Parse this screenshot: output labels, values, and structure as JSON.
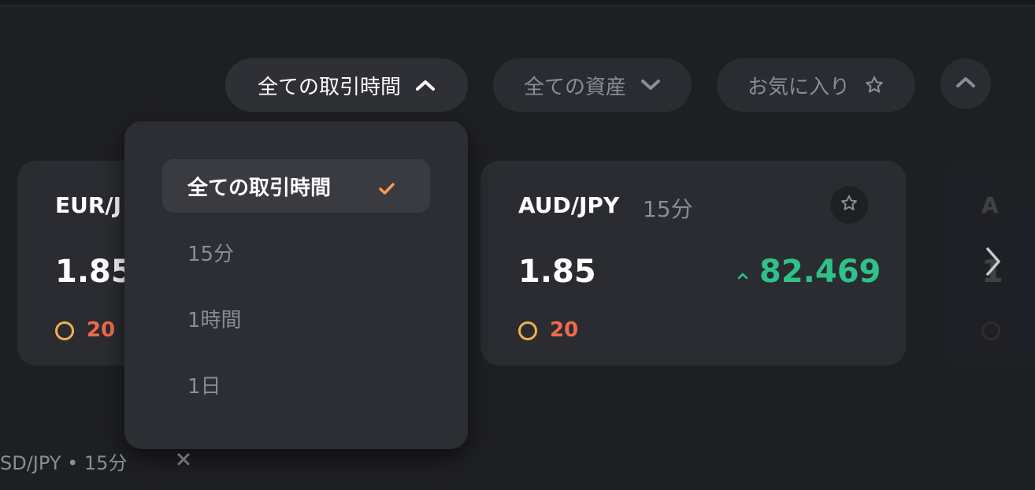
{
  "filters": {
    "trading_time_label": "全ての取引時間",
    "assets_label": "全ての資産",
    "favorites_label": "お気に入り"
  },
  "dropdown": {
    "items": [
      {
        "label": "全ての取引時間",
        "selected": true
      },
      {
        "label": "15分",
        "selected": false
      },
      {
        "label": "1時間",
        "selected": false
      },
      {
        "label": "1日",
        "selected": false
      }
    ]
  },
  "cards": [
    {
      "pair": "EUR/J",
      "rate": "1.85",
      "count": "20"
    },
    {
      "pair": "AUD/JPY",
      "period": "15分",
      "rate": "1.85",
      "change": "82.469",
      "count": "20"
    },
    {
      "pair": "A",
      "rate": "1"
    }
  ],
  "bottom_tab": {
    "label": "SD/JPY • 15分"
  },
  "colors": {
    "background": "#1e1f23",
    "card": "#2a2c31",
    "accent_up": "#2ec28a",
    "count_red": "#ef6b4c",
    "ring_yellow": "#f3b04a",
    "check_orange": "#f59a53"
  }
}
